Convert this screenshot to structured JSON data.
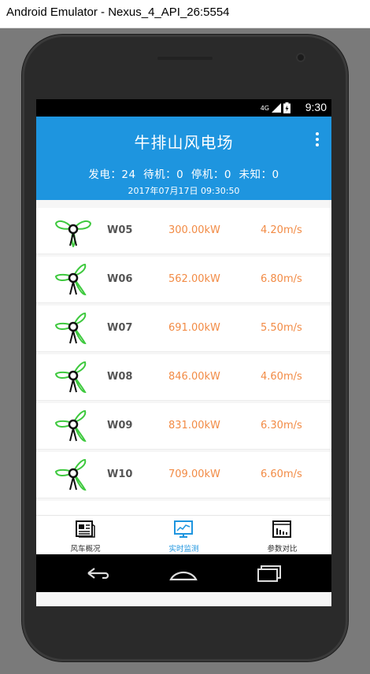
{
  "window": {
    "title": "Android Emulator - Nexus_4_API_26:5554"
  },
  "status_bar": {
    "time": "9:30",
    "network": "4G"
  },
  "app": {
    "title": "牛排山风电场",
    "summary": "发电：24  待机：0  停机：0  未知：0",
    "datetime": "2017年07月17日 09:30:50"
  },
  "turbines": [
    {
      "name": "W05",
      "power": "300.00kW",
      "wind_speed": "4.20m/s"
    },
    {
      "name": "W06",
      "power": "562.00kW",
      "wind_speed": "6.80m/s"
    },
    {
      "name": "W07",
      "power": "691.00kW",
      "wind_speed": "5.50m/s"
    },
    {
      "name": "W08",
      "power": "846.00kW",
      "wind_speed": "4.60m/s"
    },
    {
      "name": "W09",
      "power": "831.00kW",
      "wind_speed": "6.30m/s"
    },
    {
      "name": "W10",
      "power": "709.00kW",
      "wind_speed": "6.60m/s"
    }
  ],
  "bottom_nav": [
    {
      "label": "风车概况",
      "icon": "document-icon"
    },
    {
      "label": "实时监测",
      "icon": "monitor-chart-icon"
    },
    {
      "label": "参数对比",
      "icon": "bar-chart-icon"
    }
  ],
  "colors": {
    "primary": "#1e95df",
    "value_orange": "#f28b45",
    "turbine_green": "#3ec93e"
  }
}
